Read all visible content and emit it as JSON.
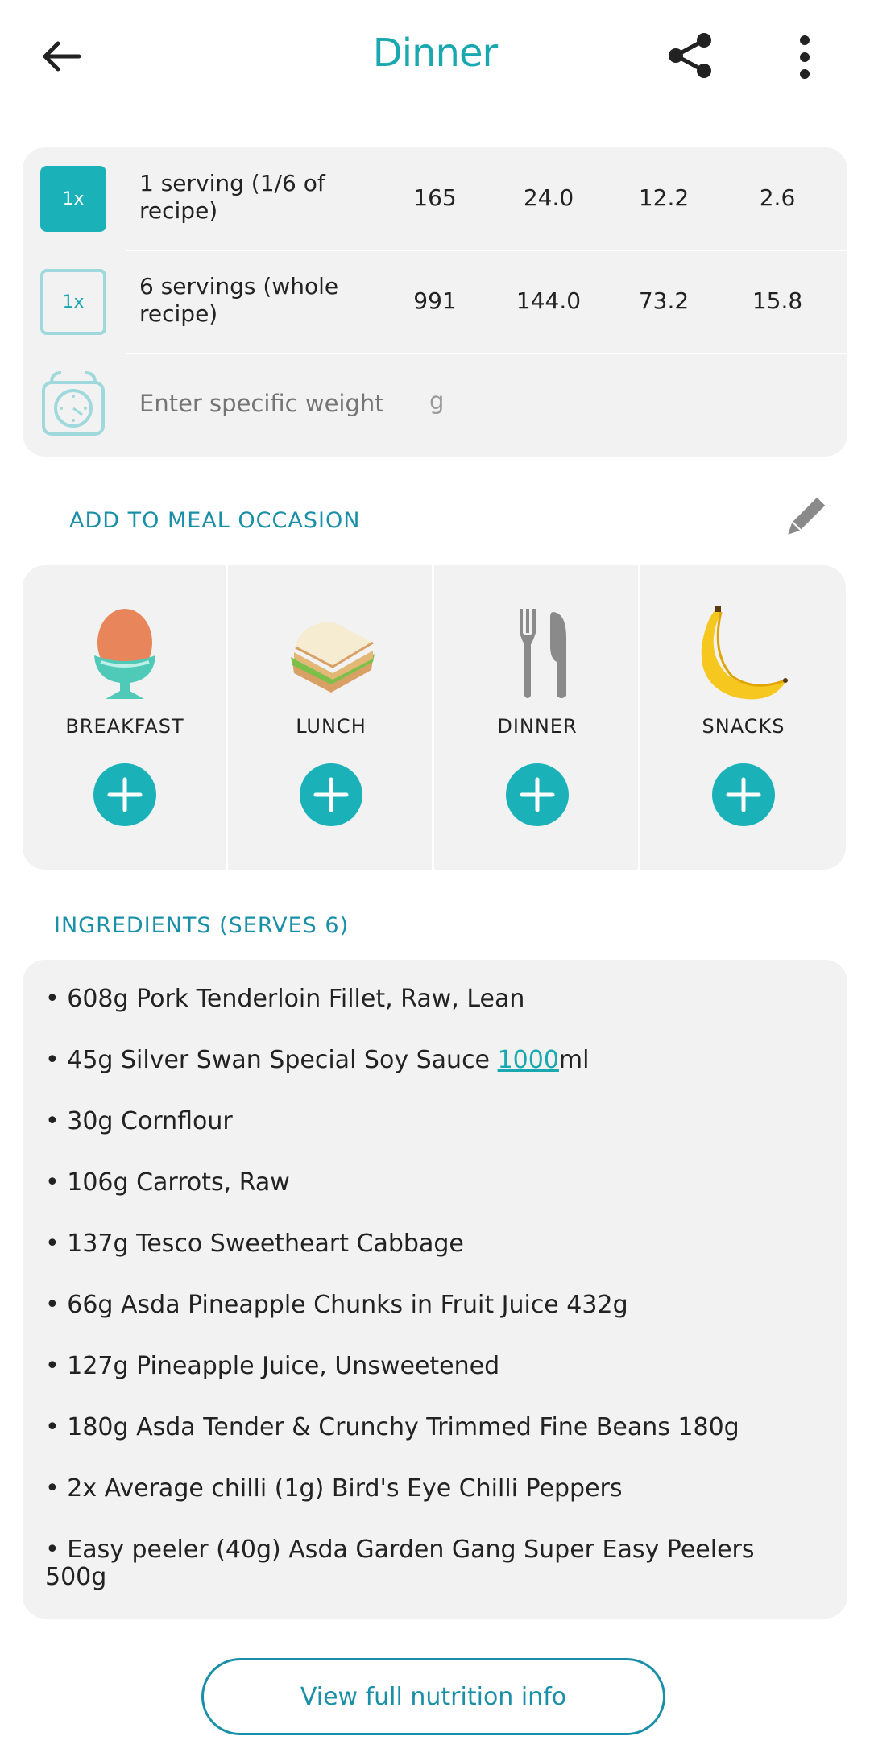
{
  "header": {
    "title": "Dinner"
  },
  "servings": [
    {
      "multiplier": "1x",
      "label": "1 serving (1/6 of recipe)",
      "values": [
        "165",
        "24.0",
        "12.2",
        "2.6"
      ]
    },
    {
      "multiplier": "1x",
      "label": "6 servings (whole recipe)",
      "values": [
        "991",
        "144.0",
        "73.2",
        "15.8"
      ]
    }
  ],
  "weight": {
    "placeholder": "Enter specific weight",
    "unit": "g"
  },
  "meal_occasion": {
    "title": "ADD TO MEAL OCCASION",
    "meals": [
      {
        "label": "BREAKFAST",
        "icon": "egg-icon"
      },
      {
        "label": "LUNCH",
        "icon": "sandwich-icon"
      },
      {
        "label": "DINNER",
        "icon": "cutlery-icon"
      },
      {
        "label": "SNACKS",
        "icon": "banana-icon"
      }
    ]
  },
  "ingredients": {
    "title": "INGREDIENTS (SERVES 6)",
    "items": [
      "608g Pork Tenderloin Fillet, Raw, Lean",
      "45g Silver Swan Special Soy Sauce ",
      "30g Cornflour",
      "106g Carrots, Raw",
      "137g Tesco Sweetheart Cabbage",
      "66g Asda Pineapple Chunks in Fruit Juice 432g",
      "127g Pineapple Juice, Unsweetened",
      "180g Asda Tender & Crunchy Trimmed Fine Beans 180g",
      "2x Average chilli (1g) Bird's Eye Chilli Peppers",
      "Easy peeler (40g) Asda Garden Gang Super Easy Peelers 500g"
    ],
    "soy_link": "1000",
    "soy_suffix": "ml",
    "bullet": "•"
  },
  "footer": {
    "button_label": "View full nutrition info"
  },
  "colors": {
    "accent": "#1ab2b8",
    "section_title": "#1a8fa8",
    "card_bg": "#f2f2f2"
  }
}
